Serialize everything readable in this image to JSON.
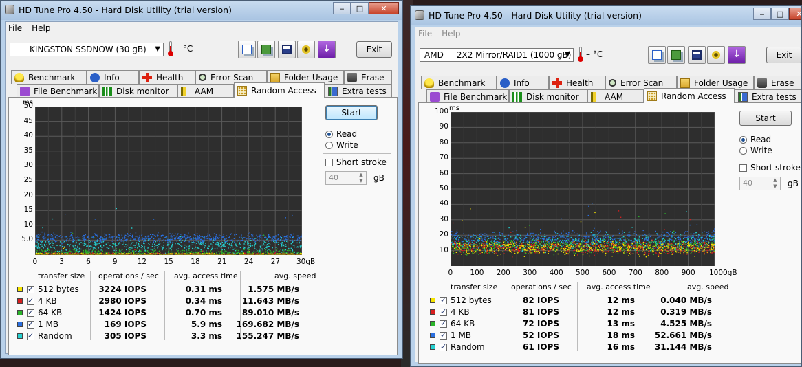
{
  "windows": [
    {
      "title": "HD Tune Pro 4.50 - Hard Disk Utility (trial version)",
      "menu": [
        "File",
        "Help"
      ],
      "drive": "KINGSTON SSDNOW  (30 gB)",
      "temp": "– °C",
      "exit_label": "Exit",
      "tabs_row1": [
        "Benchmark",
        "Info",
        "Health",
        "Error Scan",
        "Folder Usage",
        "Erase"
      ],
      "tabs_row2": [
        "File Benchmark",
        "Disk monitor",
        "AAM",
        "Random Access",
        "Extra tests"
      ],
      "start_label": "Start",
      "read_label": "Read",
      "write_label": "Write",
      "short_stroke_label": "Short stroke",
      "stroke_value": "40",
      "stroke_unit": "gB",
      "table_headers": [
        "transfer size",
        "operations / sec",
        "avg. access time",
        "avg. speed"
      ],
      "rows": [
        {
          "label": "512 bytes",
          "ops": "3224 IOPS",
          "time": "0.31 ms",
          "speed": "1.575 MB/s",
          "color": "#f5e400"
        },
        {
          "label": "4 KB",
          "ops": "2980 IOPS",
          "time": "0.34 ms",
          "speed": "11.643 MB/s",
          "color": "#d81e1e"
        },
        {
          "label": "64 KB",
          "ops": "1424 IOPS",
          "time": "0.70 ms",
          "speed": "89.010 MB/s",
          "color": "#2ab52a"
        },
        {
          "label": "1 MB",
          "ops": "169 IOPS",
          "time": "5.9 ms",
          "speed": "169.682 MB/s",
          "color": "#2a6fe0"
        },
        {
          "label": "Random",
          "ops": "305 IOPS",
          "time": "3.3 ms",
          "speed": "155.247 MB/s",
          "color": "#25d0d0"
        }
      ],
      "chart_data": {
        "type": "scatter",
        "ylabel": "ms",
        "ylim": [
          0,
          50
        ],
        "yticks": [
          "50",
          "45",
          "40",
          "35",
          "30",
          "25",
          "20",
          "15",
          "10",
          "5.0"
        ],
        "xlim": [
          0,
          30
        ],
        "xticks": [
          "0",
          "3",
          "6",
          "9",
          "12",
          "15",
          "18",
          "21",
          "24",
          "27",
          "30gB"
        ],
        "series": [
          {
            "name": "512 bytes",
            "color": "#f5e400",
            "mean": 0.31,
            "spread": 0.4
          },
          {
            "name": "4 KB",
            "color": "#d81e1e",
            "mean": 0.34,
            "spread": 0.4
          },
          {
            "name": "64 KB",
            "color": "#2ab52a",
            "mean": 0.7,
            "spread": 1.2
          },
          {
            "name": "1 MB",
            "color": "#2a6fe0",
            "mean": 5.9,
            "spread": 1.4
          },
          {
            "name": "Random",
            "color": "#25d0d0",
            "mean": 3.3,
            "spread": 2.2
          }
        ]
      }
    },
    {
      "title": "HD Tune Pro 4.50 - Hard Disk Utility (trial version)",
      "menu": [
        "File",
        "Help"
      ],
      "drive": "AMD     2X2 Mirror/RAID1 (1000 gB)",
      "temp": "– °C",
      "exit_label": "Exit",
      "tabs_row1": [
        "Benchmark",
        "Info",
        "Health",
        "Error Scan",
        "Folder Usage",
        "Erase"
      ],
      "tabs_row2": [
        "File Benchmark",
        "Disk monitor",
        "AAM",
        "Random Access",
        "Extra tests"
      ],
      "start_label": "Start",
      "read_label": "Read",
      "write_label": "Write",
      "short_stroke_label": "Short stroke",
      "stroke_value": "40",
      "stroke_unit": "gB",
      "table_headers": [
        "transfer size",
        "operations / sec",
        "avg. access time",
        "avg. speed"
      ],
      "rows": [
        {
          "label": "512 bytes",
          "ops": "82 IOPS",
          "time": "12 ms",
          "speed": "0.040 MB/s",
          "color": "#f5e400"
        },
        {
          "label": "4 KB",
          "ops": "81 IOPS",
          "time": "12 ms",
          "speed": "0.319 MB/s",
          "color": "#d81e1e"
        },
        {
          "label": "64 KB",
          "ops": "72 IOPS",
          "time": "13 ms",
          "speed": "4.525 MB/s",
          "color": "#2ab52a"
        },
        {
          "label": "1 MB",
          "ops": "52 IOPS",
          "time": "18 ms",
          "speed": "52.661 MB/s",
          "color": "#2a6fe0"
        },
        {
          "label": "Random",
          "ops": "61 IOPS",
          "time": "16 ms",
          "speed": "31.144 MB/s",
          "color": "#25d0d0"
        }
      ],
      "chart_data": {
        "type": "scatter",
        "ylabel": "ms",
        "ylim": [
          0,
          100
        ],
        "yticks": [
          "100",
          "90",
          "80",
          "70",
          "60",
          "50",
          "40",
          "30",
          "20",
          "10"
        ],
        "xlim": [
          0,
          1000
        ],
        "xticks": [
          "0",
          "100",
          "200",
          "300",
          "400",
          "500",
          "600",
          "700",
          "800",
          "900",
          "1000gB"
        ],
        "series": [
          {
            "name": "512 bytes",
            "color": "#f5e400",
            "mean": 12,
            "spread": 4
          },
          {
            "name": "4 KB",
            "color": "#d81e1e",
            "mean": 12,
            "spread": 4
          },
          {
            "name": "64 KB",
            "color": "#2ab52a",
            "mean": 13,
            "spread": 4
          },
          {
            "name": "1 MB",
            "color": "#2a6fe0",
            "mean": 18,
            "spread": 5
          },
          {
            "name": "Random",
            "color": "#25d0d0",
            "mean": 16,
            "spread": 5
          }
        ]
      }
    }
  ]
}
